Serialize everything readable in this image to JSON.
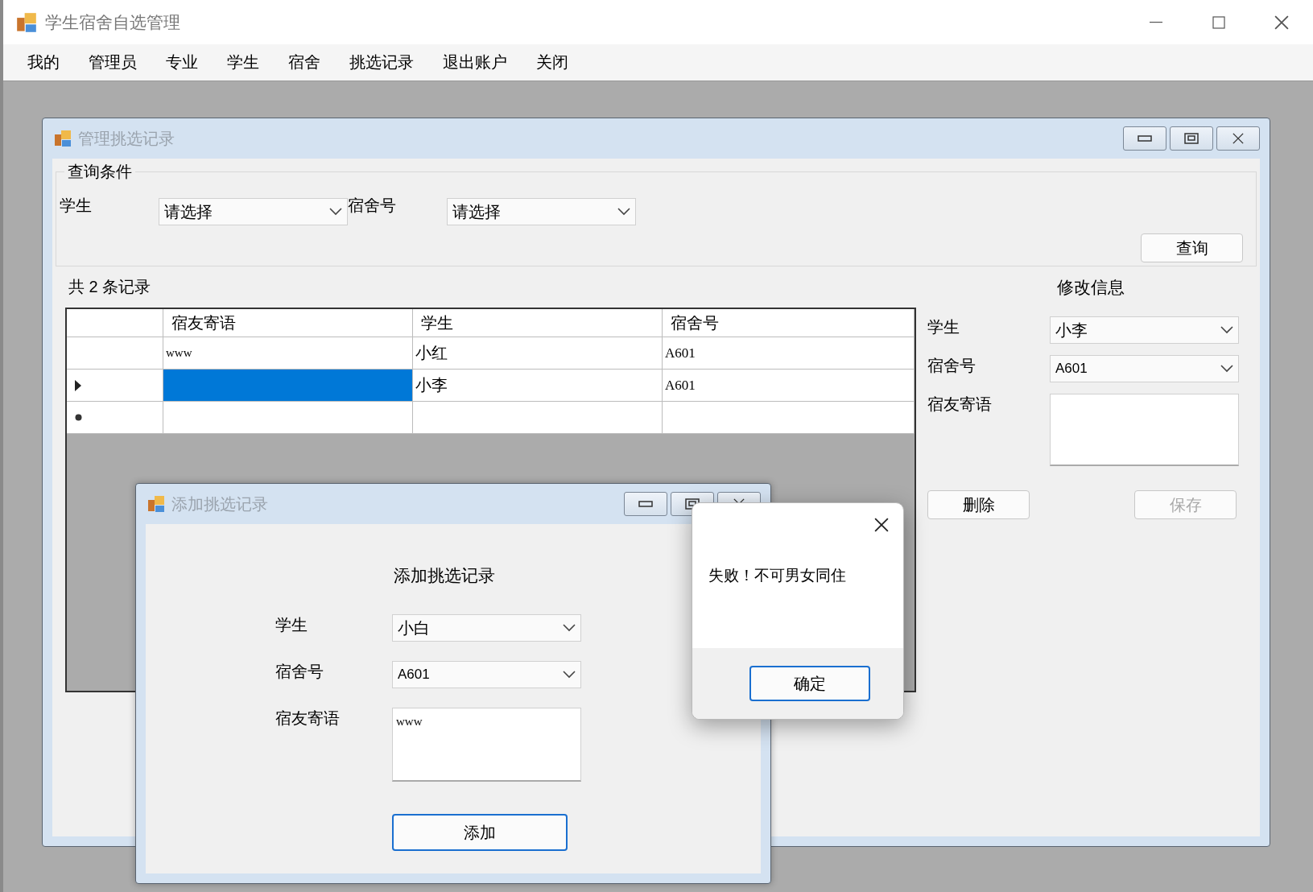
{
  "window": {
    "title": "学生宿舍自选管理"
  },
  "menu": [
    "我的",
    "管理员",
    "专业",
    "学生",
    "宿舍",
    "挑选记录",
    "退出账户",
    "关闭"
  ],
  "manage_window": {
    "title": "管理挑选记录",
    "query_group": {
      "title": "查询条件",
      "fields": [
        {
          "label": "学生",
          "value": "请选择"
        },
        {
          "label": "宿舍号",
          "value": "请选择"
        }
      ],
      "button": "查询"
    },
    "record_count": "共 2 条记录",
    "grid": {
      "columns": [
        "宿友寄语",
        "学生",
        "宿舍号"
      ],
      "rows": [
        {
          "message": "www",
          "student": "小红",
          "room": "A601",
          "selected": false
        },
        {
          "student": "小李",
          "room": "A601",
          "selected": true
        }
      ]
    },
    "edit_panel": {
      "title": "修改信息",
      "fields": [
        {
          "label": "学生",
          "value": "小李",
          "kind": "dropdown"
        },
        {
          "label": "宿舍号",
          "value": "A601",
          "kind": "dropdown"
        },
        {
          "label": "宿友寄语",
          "kind": "textarea"
        }
      ],
      "buttons": [
        {
          "label": "删除",
          "disabled": false
        },
        {
          "label": "保存",
          "disabled": true
        }
      ]
    }
  },
  "add_window": {
    "title": "添加挑选记录",
    "heading": "添加挑选记录",
    "fields": [
      {
        "label": "学生",
        "value": "小白",
        "kind": "dropdown"
      },
      {
        "label": "宿舍号",
        "value": "A601",
        "kind": "dropdown"
      },
      {
        "label": "宿友寄语",
        "value": "www",
        "kind": "textarea"
      }
    ],
    "button": "添加"
  },
  "message_box": {
    "text": "失败！不可男女同住",
    "button": "确定"
  }
}
